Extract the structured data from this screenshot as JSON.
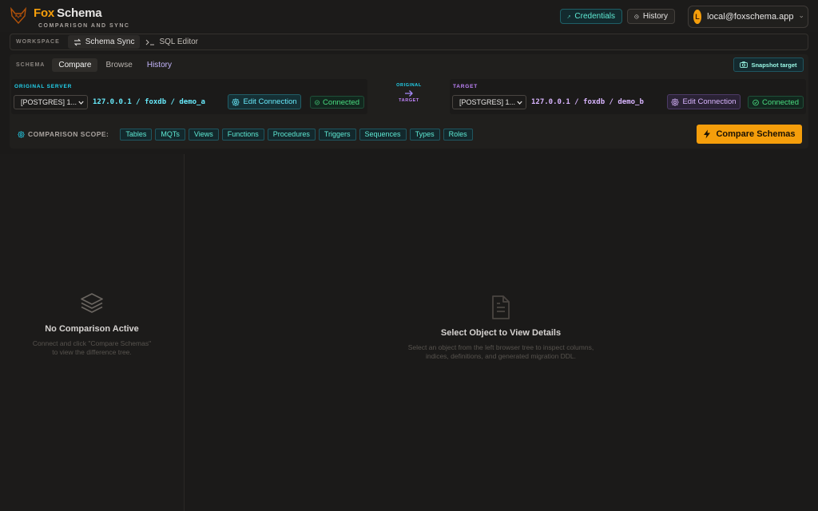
{
  "app": {
    "brand_fox": "Fox",
    "brand_schema": "Schema",
    "tagline": "COMPARISON AND SYNC"
  },
  "header": {
    "credentials_label": "Credentials",
    "history_label": "History",
    "user": {
      "initial": "L",
      "email": "local@foxschema.app"
    }
  },
  "workspace": {
    "label": "WORKSPACE",
    "tabs": [
      {
        "label": "Schema Sync",
        "icon": "sync-icon",
        "active": true
      },
      {
        "label": "SQL Editor",
        "icon": "terminal-icon",
        "active": false
      }
    ]
  },
  "schema": {
    "label": "SCHEMA",
    "tabs": [
      {
        "label": "Compare",
        "active": true
      },
      {
        "label": "Browse",
        "active": false
      },
      {
        "label": "History",
        "active": false
      }
    ],
    "snapshot_label": "Snapshot target"
  },
  "original": {
    "label": "ORIGINAL SERVER",
    "select_value": "[POSTGRES] 1...",
    "connection": "127.0.0.1 / foxdb / demo_a",
    "edit_label": "Edit Connection",
    "status": "Connected"
  },
  "direction": {
    "top": "ORIGINAL",
    "bottom": "TARGET"
  },
  "target": {
    "label": "TARGET",
    "select_value": "[POSTGRES] 1...",
    "connection": "127.0.0.1 / foxdb / demo_b",
    "edit_label": "Edit Connection",
    "status": "Connected"
  },
  "scope": {
    "label": "COMPARISON SCOPE:",
    "chips": [
      "Tables",
      "MQTs",
      "Views",
      "Functions",
      "Procedures",
      "Triggers",
      "Sequences",
      "Types",
      "Roles"
    ],
    "compare_label": "Compare Schemas"
  },
  "left_empty": {
    "title": "No Comparison Active",
    "description": "Connect and click \"Compare Schemas\" to view the difference tree."
  },
  "right_empty": {
    "title": "Select Object to View Details",
    "description": "Select an object from the left browser tree to inspect columns, indices, definitions, and generated migration DDL."
  },
  "colors": {
    "accent": "#f59e0b",
    "teal": "#5eead4",
    "purple": "#c084fc",
    "success": "#4ade80"
  }
}
